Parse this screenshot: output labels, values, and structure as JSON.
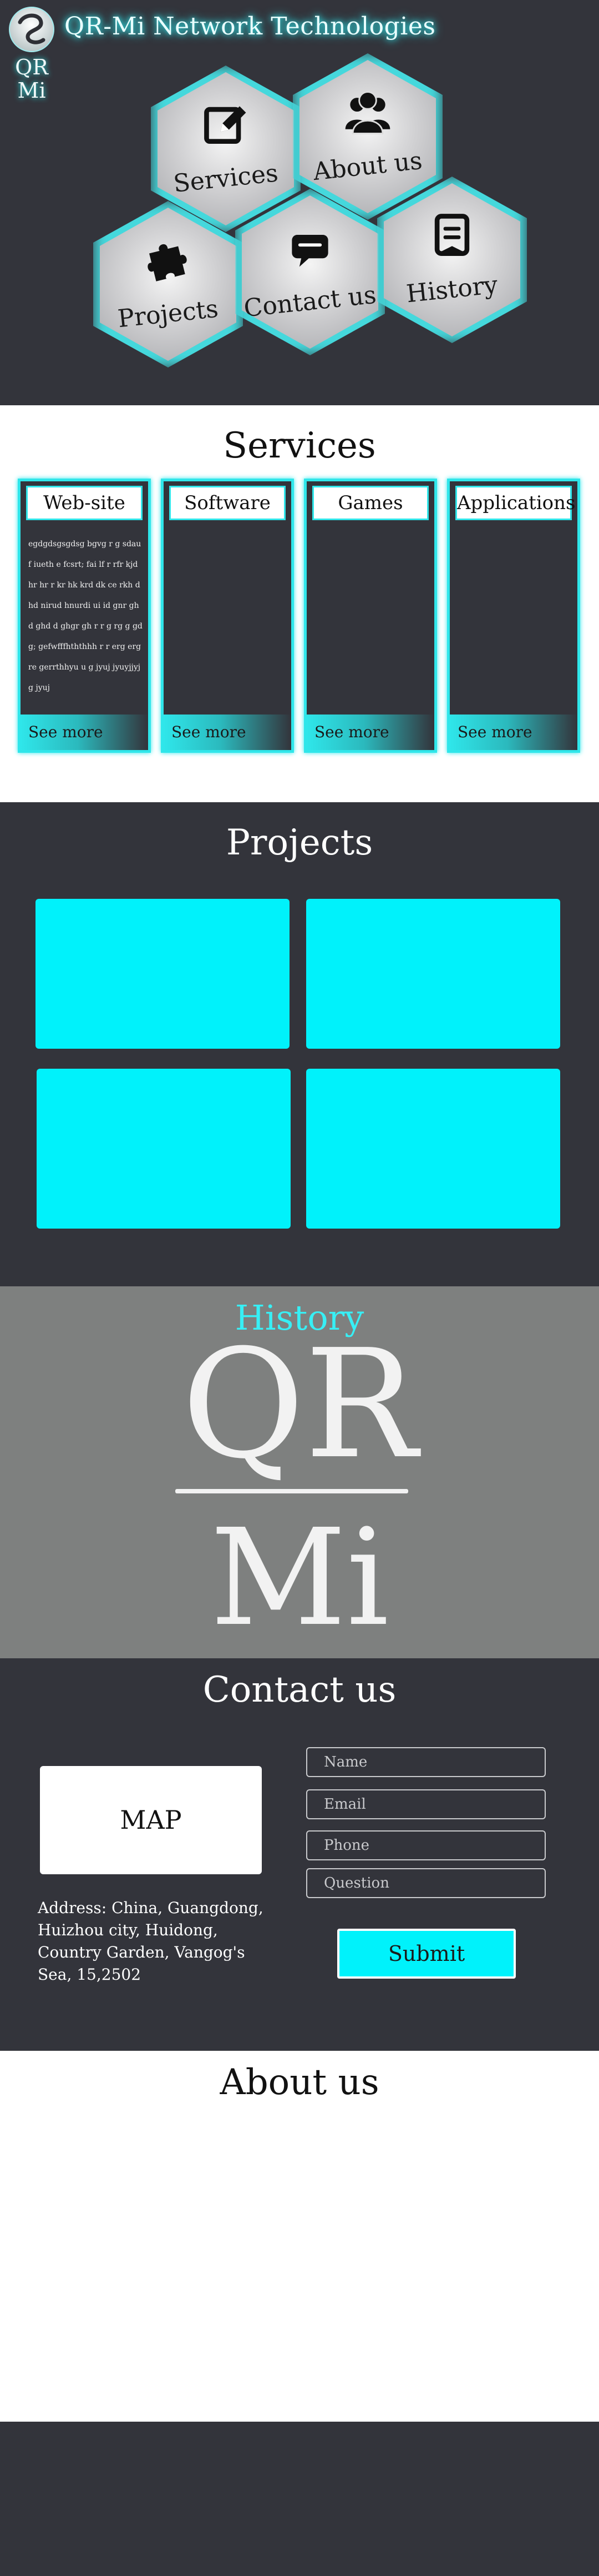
{
  "header": {
    "brand": "QR-Mi Network Technologies",
    "logo_line1": "QR",
    "logo_line2": "Mi",
    "nav": [
      {
        "label": "Services",
        "icon": "edit-icon"
      },
      {
        "label": "About us",
        "icon": "users-icon"
      },
      {
        "label": "Projects",
        "icon": "puzzle-icon"
      },
      {
        "label": "Contact us",
        "icon": "chat-icon"
      },
      {
        "label": "History",
        "icon": "document-icon"
      }
    ],
    "accent_color": "#2fe6ea"
  },
  "services": {
    "title": "Services",
    "cards": [
      {
        "title": "Web-site",
        "text": "egdgdsgsgdsg bgvg r g sdauf iueth e fcsrt; fai lf r rfr kjdhr hr r kr hk krd dk ce rkh d hd nirud hnurdi ui id gnr gh d ghd d ghgr gh r r g rg g gd g; gefwfffhththhh r r erg erg re gerrthhyu u g jyuj jyuyjjyj g jyuj",
        "more": "See more"
      },
      {
        "title": "Software",
        "text": "",
        "more": "See more"
      },
      {
        "title": "Games",
        "text": "",
        "more": "See more"
      },
      {
        "title": "Applications",
        "text": "",
        "more": "See more"
      }
    ]
  },
  "projects": {
    "title": "Projects",
    "tile_color": "#00f2fb"
  },
  "history": {
    "title": "History",
    "big_line1": "QR",
    "big_line2": "Mi"
  },
  "contact": {
    "title": "Contact us",
    "map_label": "MAP",
    "address": "Address:   China, Guangdong, Huizhou city, Huidong, Country Garden, Vangog's Sea, 15,2502",
    "fields": {
      "name_placeholder": "Name",
      "email_placeholder": "Email",
      "phone_placeholder": "Phone",
      "question_placeholder": "Question"
    },
    "submit_label": "Submit"
  },
  "about": {
    "title": "About us"
  }
}
